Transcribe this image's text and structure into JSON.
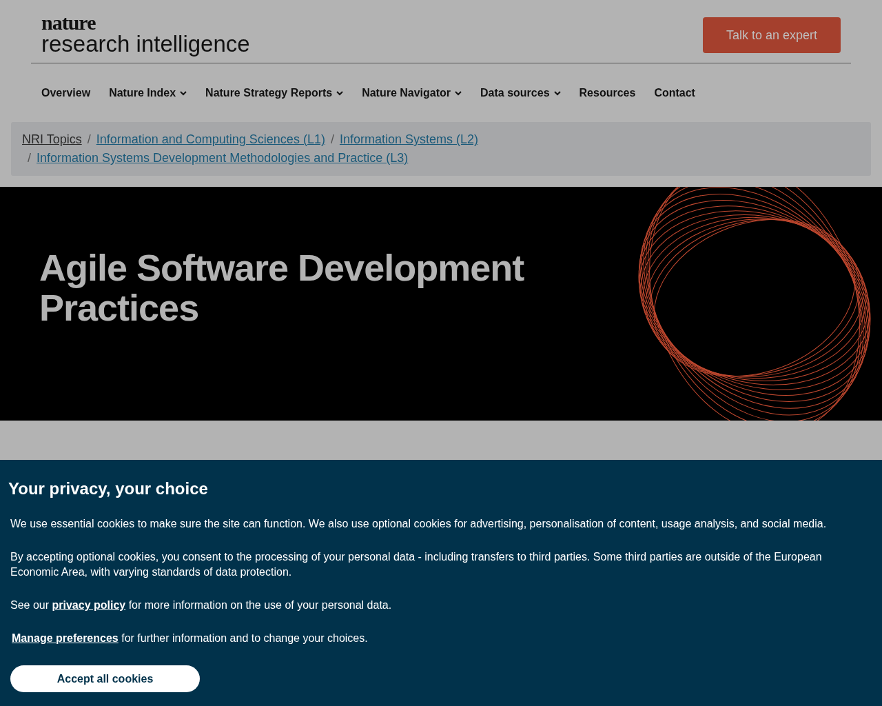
{
  "header": {
    "logo": {
      "top": "nature",
      "bottom": "research intelligence"
    },
    "cta": "Talk to an expert"
  },
  "nav": [
    {
      "label": "Overview",
      "dropdown": false
    },
    {
      "label": "Nature Index",
      "dropdown": true
    },
    {
      "label": "Nature Strategy Reports",
      "dropdown": true
    },
    {
      "label": "Nature Navigator",
      "dropdown": true
    },
    {
      "label": "Data sources",
      "dropdown": true
    },
    {
      "label": "Resources",
      "dropdown": false
    },
    {
      "label": "Contact",
      "dropdown": false
    }
  ],
  "breadcrumb": [
    {
      "label": "NRI Topics",
      "kind": "plain"
    },
    {
      "label": "Information and Computing Sciences (L1)",
      "kind": "link"
    },
    {
      "label": "Information Systems (L2)",
      "kind": "link"
    },
    {
      "label": "Information Systems Development Methodologies and Practice (L3)",
      "kind": "link"
    }
  ],
  "hero": {
    "title": "Agile Software Development Practices"
  },
  "breadcrumb_separator": "/",
  "cookie_banner": {
    "title": "Your privacy, your choice",
    "paragraphs": [
      "We use essential cookies to make sure the site can function. We also use optional cookies for advertising, personalisation of content, usage analysis, and social media.",
      "By accepting optional cookies, you consent to the processing of your personal data - including transfers to third parties. Some third parties are outside of the European Economic Area, with varying standards of data protection."
    ],
    "policy": {
      "before": "See our ",
      "link": "privacy policy",
      "after": " for more information on the use of your personal data."
    },
    "manage": {
      "link": "Manage preferences",
      "after": " for further information and to change your choices."
    },
    "accept": "Accept all cookies"
  }
}
